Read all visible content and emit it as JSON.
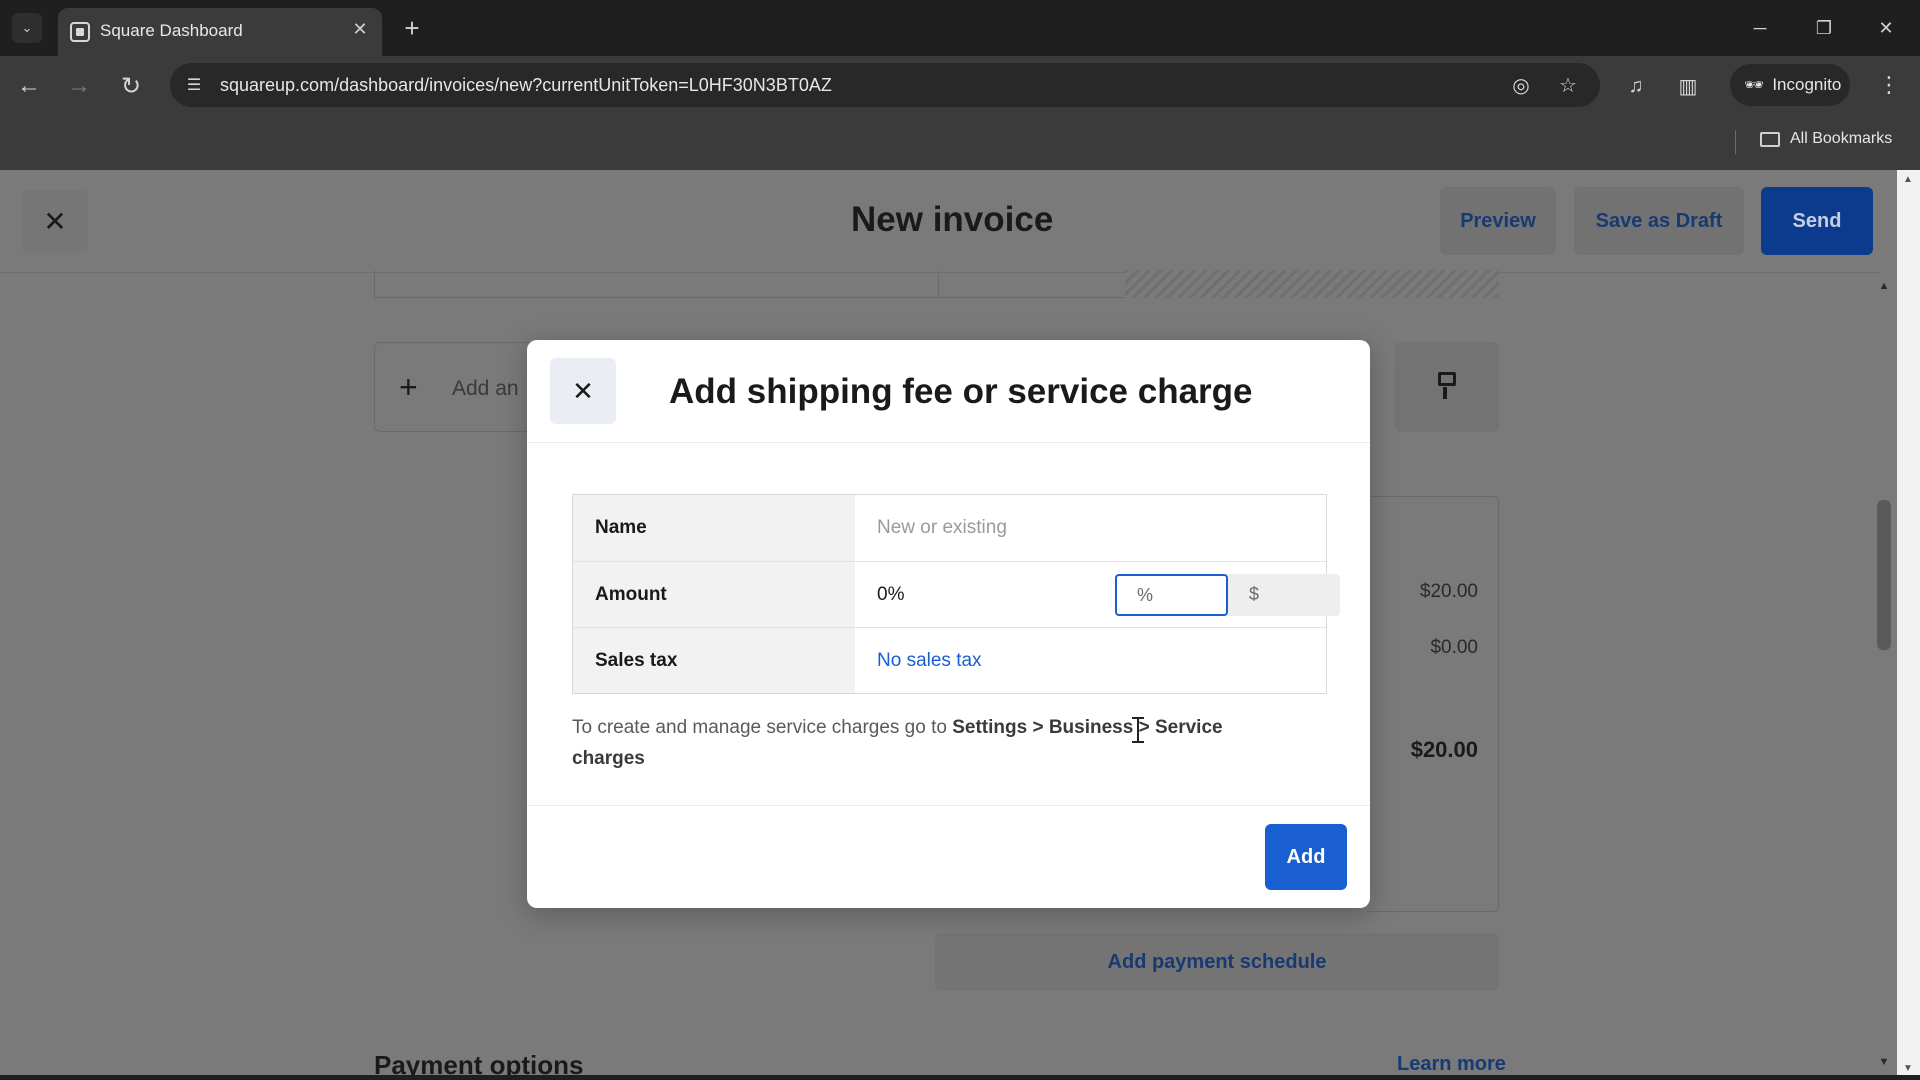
{
  "browser": {
    "tab_title": "Square Dashboard",
    "url": "squareup.com/dashboard/invoices/new?currentUnitToken=L0HF30N3BT0AZ",
    "profile_label": "Incognito",
    "bookmarks_label": "All Bookmarks"
  },
  "page": {
    "title": "New invoice",
    "preview_label": "Preview",
    "save_draft_label": "Save as Draft",
    "send_label": "Send",
    "add_item_label": "Add an",
    "summary": {
      "subtotal": "$20.00",
      "tax": "$0.00",
      "total": "$20.00"
    },
    "add_payment_schedule_label": "Add payment schedule",
    "payment_options_heading": "Payment options",
    "learn_more_label": "Learn more"
  },
  "modal": {
    "title": "Add shipping fee or service charge",
    "name_label": "Name",
    "name_placeholder": "New or existing",
    "amount_label": "Amount",
    "amount_value": "0%",
    "unit_percent": "%",
    "unit_dollar": "$",
    "sales_tax_label": "Sales tax",
    "sales_tax_value": "No sales tax",
    "help_prefix": "To create and manage service charges go to ",
    "help_path": "Settings > Business > Service charges",
    "add_label": "Add"
  },
  "colors": {
    "accent": "#1a5fd1",
    "send_button": "#0c3a8c"
  },
  "icons": [
    "close-icon",
    "plus-icon",
    "paint-brush-icon",
    "star-icon",
    "incognito-icon",
    "folder-icon"
  ]
}
